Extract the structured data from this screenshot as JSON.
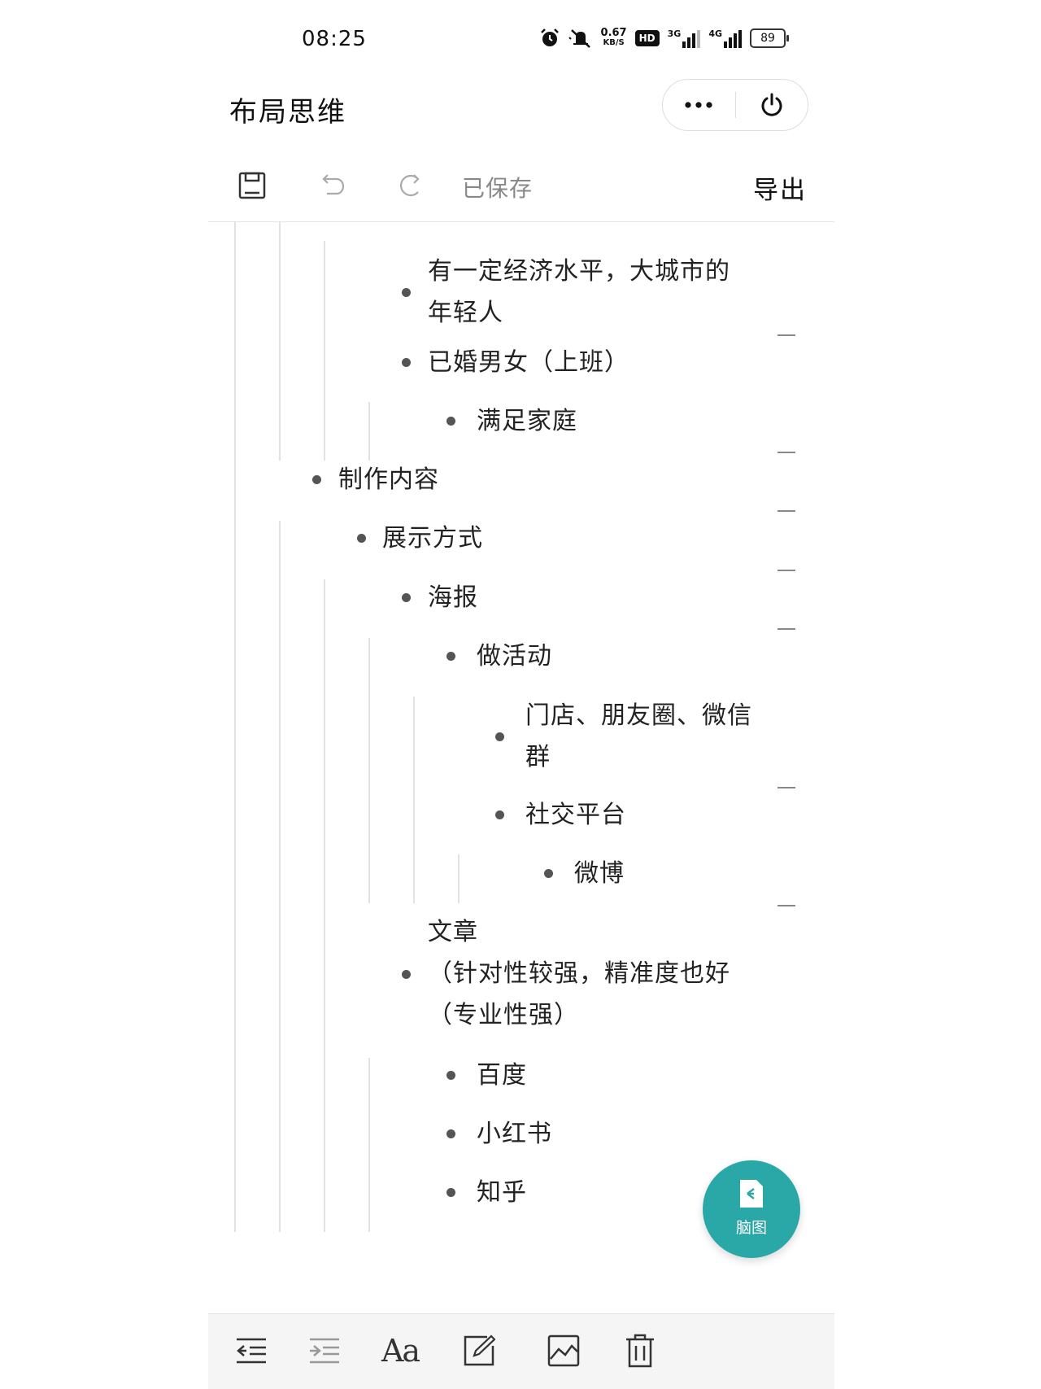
{
  "status_bar": {
    "time": "08:25",
    "net_speed": "0.67",
    "net_unit": "KB/S",
    "hd": "HD",
    "sim1_type": "3G",
    "sim2_type": "4G",
    "battery": "89"
  },
  "header": {
    "title": "布局思维",
    "more_icon": "ellipsis-icon",
    "power_icon": "power-icon"
  },
  "toolbar": {
    "save_icon": "floppy-icon",
    "undo_icon": "undo-icon",
    "redo_icon": "redo-icon",
    "status": "已保存",
    "export_label": "导出"
  },
  "outline": {
    "nodes": [
      {
        "id": "n1",
        "line1": "有一定经济水平，大城市的",
        "line2": "年轻人",
        "collapsible": false
      },
      {
        "id": "n2",
        "line1": "已婚男女（上班）",
        "collapsible": true
      },
      {
        "id": "n3",
        "line1": "满足家庭",
        "collapsible": false
      },
      {
        "id": "n4",
        "line1": "制作内容",
        "collapsible": true
      },
      {
        "id": "n5",
        "line1": "展示方式",
        "collapsible": true
      },
      {
        "id": "n6",
        "line1": "海报",
        "collapsible": true
      },
      {
        "id": "n7",
        "line1": "做活动",
        "collapsible": true
      },
      {
        "id": "n8",
        "line1": "门店、朋友圈、微信",
        "line2": "群",
        "collapsible": false
      },
      {
        "id": "n9",
        "line1": "社交平台",
        "collapsible": true
      },
      {
        "id": "n10",
        "line1": "微博",
        "collapsible": false
      },
      {
        "id": "n11",
        "line1": "文章",
        "line2": "（针对性较强，精准度也好",
        "line3": "（专业性强）",
        "collapsible": true
      },
      {
        "id": "n12",
        "line1": "百度",
        "collapsible": false
      },
      {
        "id": "n13",
        "line1": "小红书",
        "collapsible": false
      },
      {
        "id": "n14",
        "line1": "知乎",
        "collapsible": false
      }
    ]
  },
  "fab": {
    "label": "脑图",
    "icon": "mindmap-icon",
    "color": "#2aa8a8"
  },
  "bottom_bar": {
    "items": [
      "outdent-icon",
      "indent-icon",
      "font-icon",
      "edit-note-icon",
      "image-icon",
      "delete-icon"
    ],
    "font_label": "Aa"
  }
}
